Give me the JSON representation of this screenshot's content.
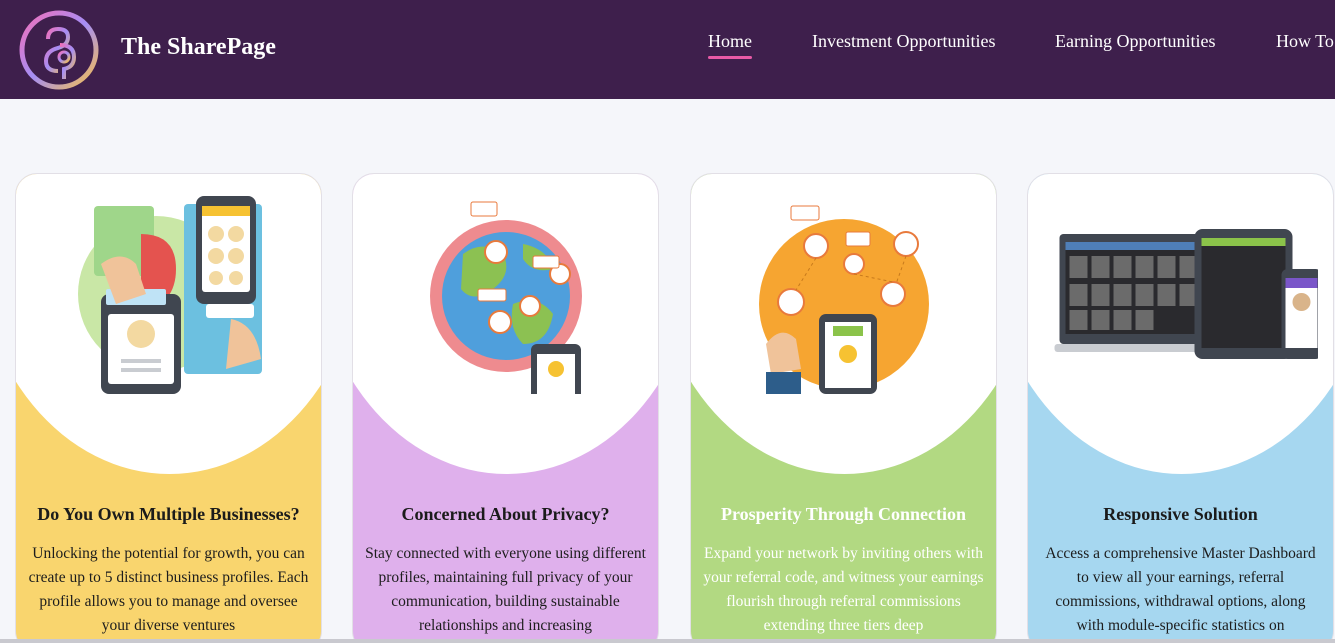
{
  "header": {
    "brand": "The SharePage",
    "logo_icon": "sharepage-logo-icon",
    "nav": [
      {
        "label": "Home",
        "active": true
      },
      {
        "label": "Investment Opportunities",
        "active": false
      },
      {
        "label": "Earning Opportunities",
        "active": false
      },
      {
        "label": "How To",
        "active": false
      }
    ]
  },
  "cards": [
    {
      "title": "Do You Own Multiple Businesses?",
      "description": "Unlocking the potential for growth, you can create up to 5 distinct business profiles. Each profile allows you to manage and oversee your diverse ventures",
      "bg_color": "#f9d56e",
      "icon": "multiple-profiles-phones-icon"
    },
    {
      "title": "Concerned About Privacy?",
      "description": "Stay connected with everyone using different profiles, maintaining full privacy of your communication, building sustainable relationships and increasing",
      "bg_color": "#dfb0ec",
      "icon": "globe-network-icon"
    },
    {
      "title": "Prosperity Through Connection",
      "description": "Expand your network by inviting others with your referral code, and witness your earnings flourish through referral commissions extending three tiers deep",
      "bg_color": "#b2d982",
      "icon": "referral-network-icon"
    },
    {
      "title": "Responsive Solution",
      "description": "Access a comprehensive Master Dashboard to view all your earnings, referral commissions, withdrawal options, along with module-specific statistics on",
      "bg_color": "#a6d7f0",
      "icon": "responsive-devices-icon"
    }
  ]
}
